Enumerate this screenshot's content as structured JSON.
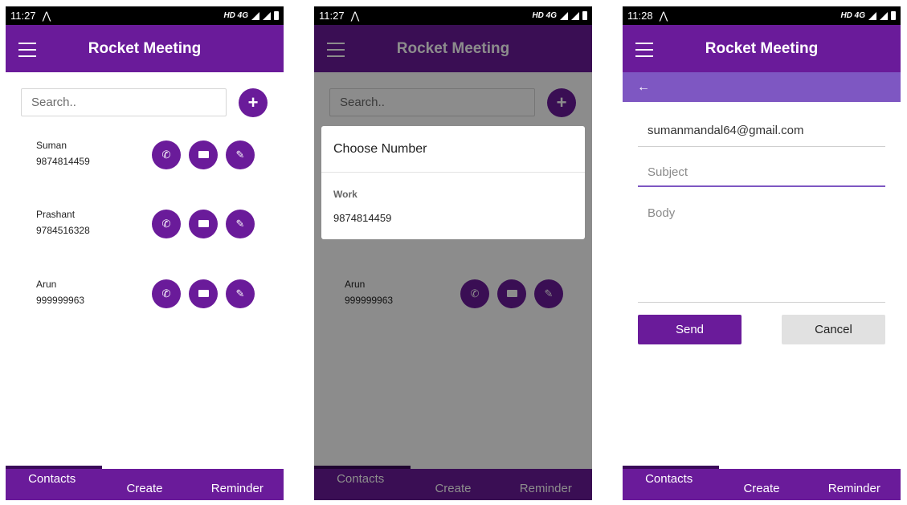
{
  "status": {
    "screen1_time": "11:27",
    "screen2_time": "11:27",
    "screen3_time": "11:28",
    "network": "HD 4G"
  },
  "app": {
    "title": "Rocket Meeting"
  },
  "search": {
    "placeholder": "Search.."
  },
  "contacts": [
    {
      "name": "Suman",
      "number": "9874814459"
    },
    {
      "name": "Prashant",
      "number": "9784516328"
    },
    {
      "name": "Arun",
      "number": "999999963"
    }
  ],
  "nav": {
    "contacts": "Contacts",
    "create": "Create",
    "reminder": "Reminder"
  },
  "dialog": {
    "title": "Choose Number",
    "label": "Work",
    "number": "9874814459"
  },
  "email": {
    "to": "sumanmandal64@gmail.com",
    "subject_placeholder": "Subject",
    "body_placeholder": "Body",
    "send": "Send",
    "cancel": "Cancel"
  },
  "colors": {
    "primary": "#6a1b9a",
    "secondary": "#7e57c2"
  },
  "icons": [
    "menu-icon",
    "plus-icon",
    "phone-icon",
    "mail-icon",
    "edit-icon",
    "back-arrow-icon",
    "signal-icon",
    "battery-icon",
    "wifi-icon"
  ]
}
